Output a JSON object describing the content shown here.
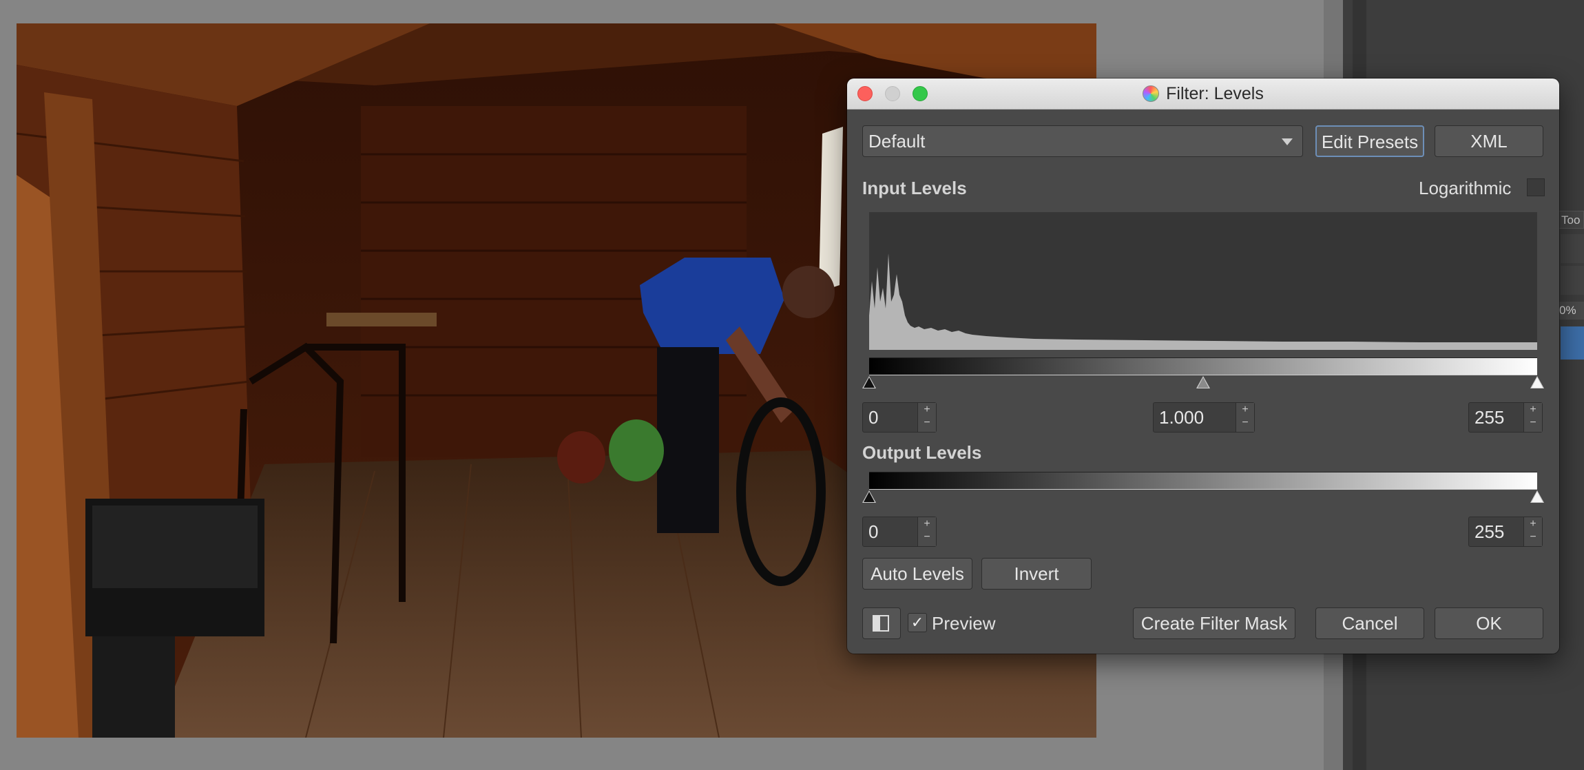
{
  "dialog": {
    "title": "Filter: Levels",
    "preset_value": "Default",
    "edit_presets_label": "Edit Presets",
    "xml_label": "XML",
    "input_levels_label": "Input Levels",
    "logarithmic_label": "Logarithmic",
    "logarithmic_checked": false,
    "input_black": "0",
    "input_gamma": "1.000",
    "input_white": "255",
    "output_levels_label": "Output Levels",
    "output_black": "0",
    "output_white": "255",
    "auto_levels_label": "Auto Levels",
    "invert_label": "Invert",
    "preview_label": "Preview",
    "preview_checked": true,
    "preview_check_glyph": "✓",
    "create_filter_mask_label": "Create Filter Mask",
    "cancel_label": "Cancel",
    "ok_label": "OK",
    "spin_up": "+",
    "spin_down": "−"
  },
  "docker": {
    "tools_tab_label": "Too",
    "zoom_fragment": "0%"
  },
  "icons": {
    "window_icon": "colorful-filter-icon",
    "dropdown_arrow": "chevron-down-icon",
    "compare_icon": "split-view-icon"
  },
  "colors": {
    "dialog_bg": "#494949",
    "selection_blue": "#3d6ea8",
    "close_red": "#fc605c",
    "zoom_green": "#34c84a"
  }
}
